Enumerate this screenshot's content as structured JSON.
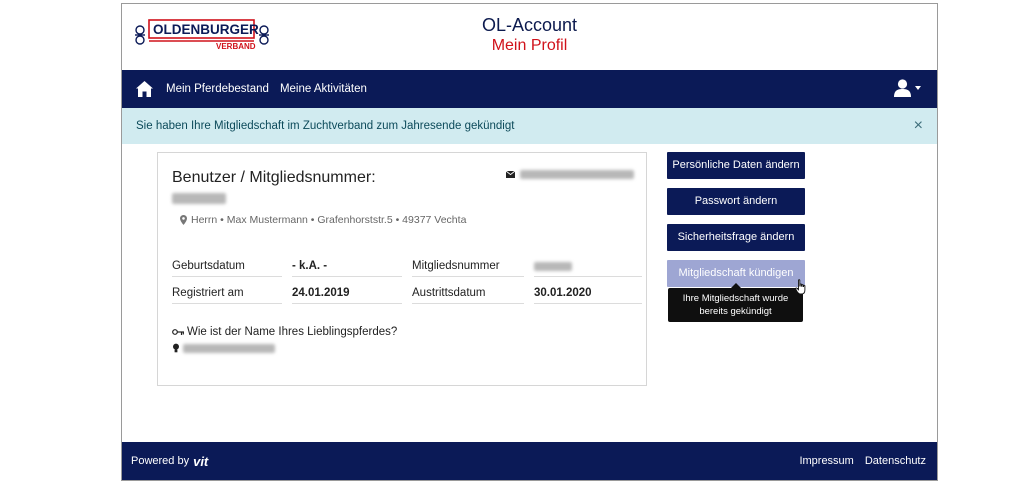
{
  "brand": {
    "logo_top": "OLDENBURGER",
    "logo_bottom": "VERBAND",
    "accent_red": "#d0121b",
    "navy": "#0b1a57"
  },
  "header": {
    "title": "OL-Account",
    "subtitle": "Mein Profil"
  },
  "nav": {
    "items": [
      {
        "label": "Mein Pferdebestand"
      },
      {
        "label": "Meine Aktivitäten"
      }
    ],
    "home_icon": "home-icon",
    "user_icon": "user-icon"
  },
  "alert": {
    "text": "Sie haben Ihre Mitgliedschaft im Zuchtverband zum Jahresende gekündigt",
    "close": "×"
  },
  "profile": {
    "title": "Benutzer / Mitgliedsnummer:",
    "address": "Herrn • Max Mustermann • Grafenhorststr.5 • 49377 Vechta",
    "rows": [
      {
        "label1": "Geburtsdatum",
        "value1": "- k.A. -",
        "label2": "Mitgliedsnummer",
        "value2": ""
      },
      {
        "label1": "Registriert am",
        "value1": "24.01.2019",
        "label2": "Austrittsdatum",
        "value2": "30.01.2020"
      }
    ],
    "security_question": "Wie ist der Name Ihres Lieblingspferdes?"
  },
  "actions": {
    "edit_personal": "Persönliche Daten ändern",
    "change_password": "Passwort ändern",
    "change_security_question": "Sicherheitsfrage ändern",
    "cancel_membership": "Mitgliedschaft kündigen",
    "cancel_tooltip": "Ihre Mitgliedschaft wurde bereits gekündigt"
  },
  "footer": {
    "powered_by": "Powered by",
    "powered_brand": "vit",
    "links": [
      {
        "label": "Impressum"
      },
      {
        "label": "Datenschutz"
      }
    ]
  }
}
